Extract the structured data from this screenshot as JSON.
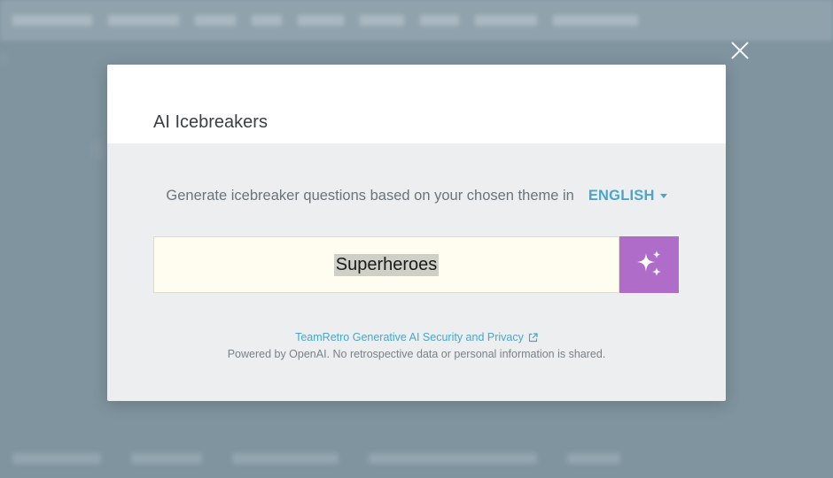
{
  "modal": {
    "title": "AI Icebreakers",
    "intro_text": "Generate icebreaker questions based on your chosen theme in",
    "language": "ENGLISH",
    "theme_input_value": "Superheroes",
    "generate_icon": "sparkles-icon",
    "privacy_link": "TeamRetro Generative AI Security and Privacy",
    "privacy_link_icon": "external-link-icon",
    "powered_by": "Powered by OpenAI. No retrospective data or personal information is shared.",
    "close_icon": "close-icon"
  },
  "colors": {
    "accent": "#4aa7c9",
    "generate_button": "#b06cc9",
    "input_background": "#fefdef",
    "overlay": "#7f949f"
  }
}
